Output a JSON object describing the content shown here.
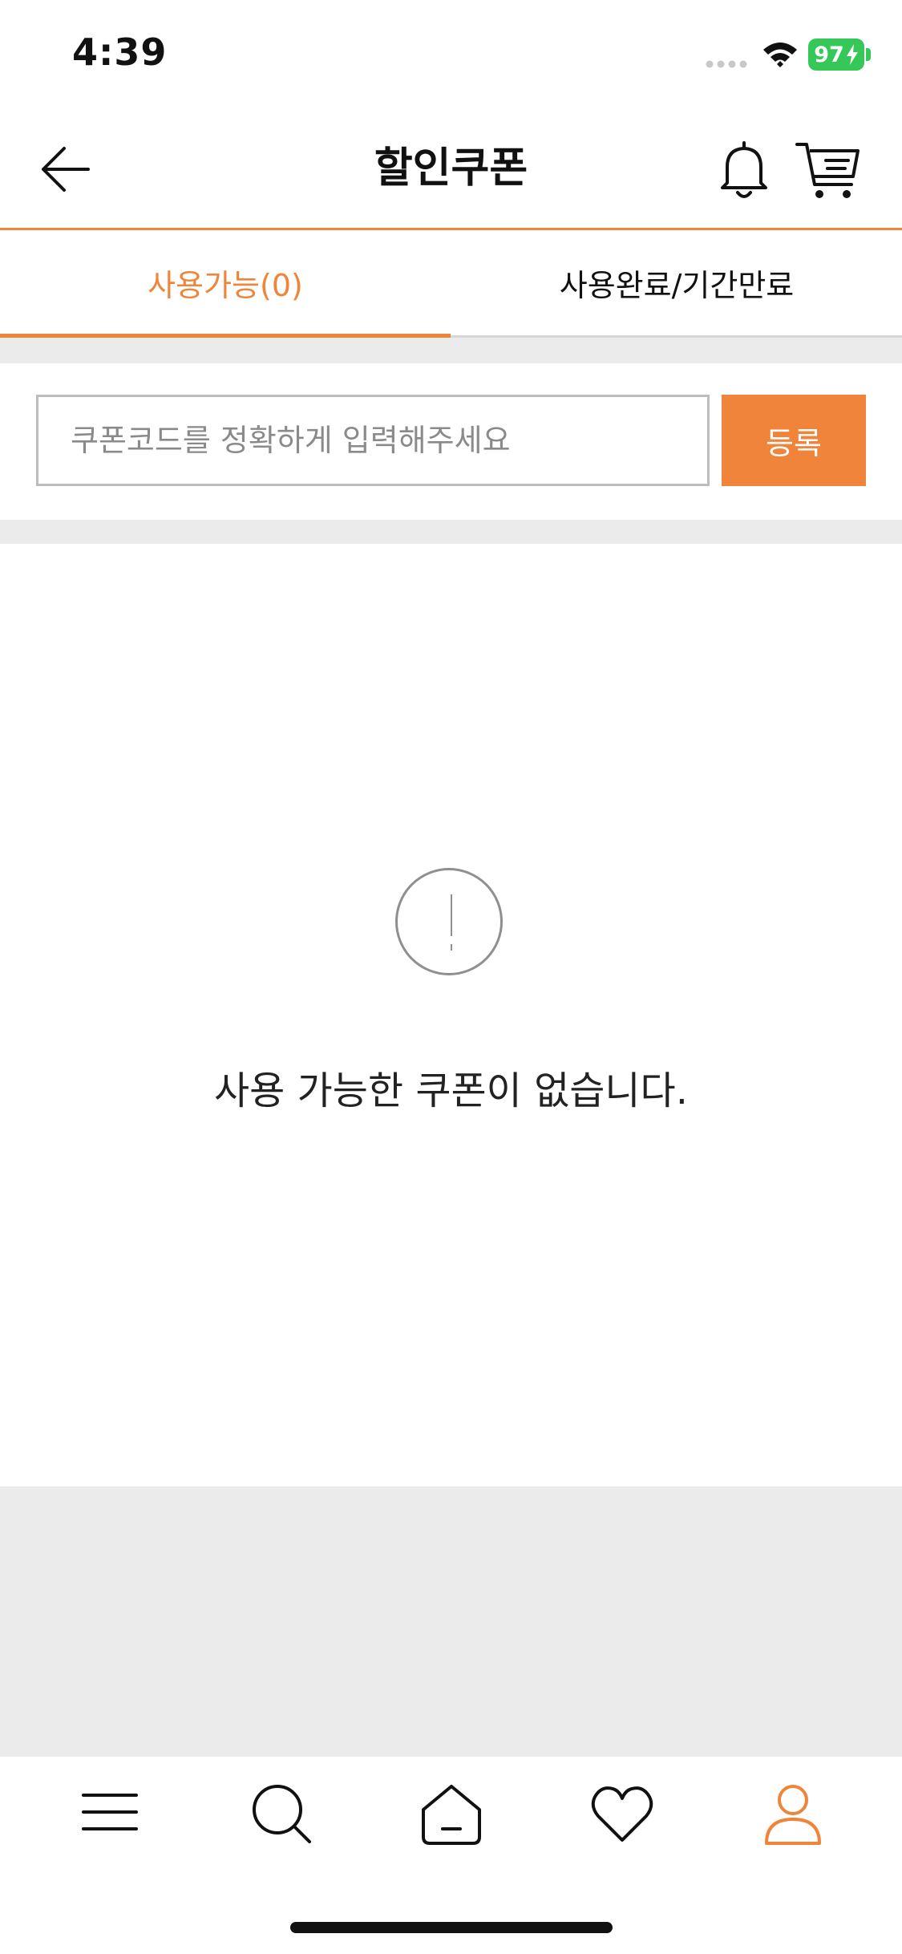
{
  "colors": {
    "accent": "#f0843a",
    "grey_bg": "#ebebeb",
    "battery_green": "#36c759"
  },
  "status_bar": {
    "time": "4:39",
    "battery": "97"
  },
  "header": {
    "title": "할인쿠폰",
    "icons": [
      "back-arrow-icon",
      "bell-icon",
      "cart-icon"
    ]
  },
  "tabs": [
    {
      "label": "사용가능(0)",
      "active": true
    },
    {
      "label": "사용완료/기간만료",
      "active": false
    }
  ],
  "coupon": {
    "placeholder": "쿠폰코드를 정확하게 입력해주세요",
    "value": "",
    "register_label": "등록"
  },
  "empty_state": {
    "icon": "exclamation-circle-icon",
    "message": "사용 가능한 쿠폰이 없습니다."
  },
  "bottom_nav": {
    "items": [
      {
        "icon": "menu-icon",
        "active": false
      },
      {
        "icon": "search-icon",
        "active": false
      },
      {
        "icon": "home-icon",
        "active": false
      },
      {
        "icon": "heart-icon",
        "active": false
      },
      {
        "icon": "user-icon",
        "active": true
      }
    ]
  }
}
